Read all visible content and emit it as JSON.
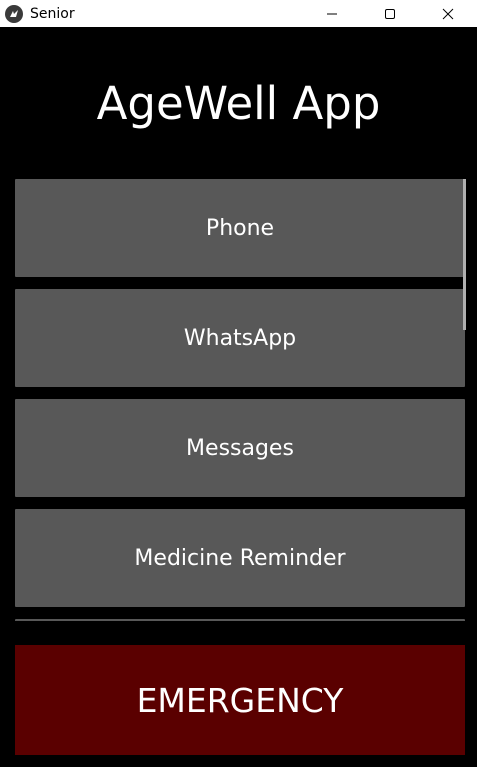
{
  "window": {
    "title": "Senior",
    "app_icon": "kivy-icon",
    "controls": [
      "minimize-icon",
      "maximize-icon",
      "close-icon"
    ]
  },
  "app": {
    "title": "AgeWell App",
    "menu_items": [
      {
        "label": "Phone"
      },
      {
        "label": "WhatsApp"
      },
      {
        "label": "Messages"
      },
      {
        "label": "Medicine Reminder"
      },
      {
        "label": ""
      }
    ],
    "emergency_label": "EMERGENCY",
    "colors": {
      "background": "#000000",
      "button": "#585858",
      "emergency": "#5a0000",
      "text": "#ffffff"
    }
  }
}
